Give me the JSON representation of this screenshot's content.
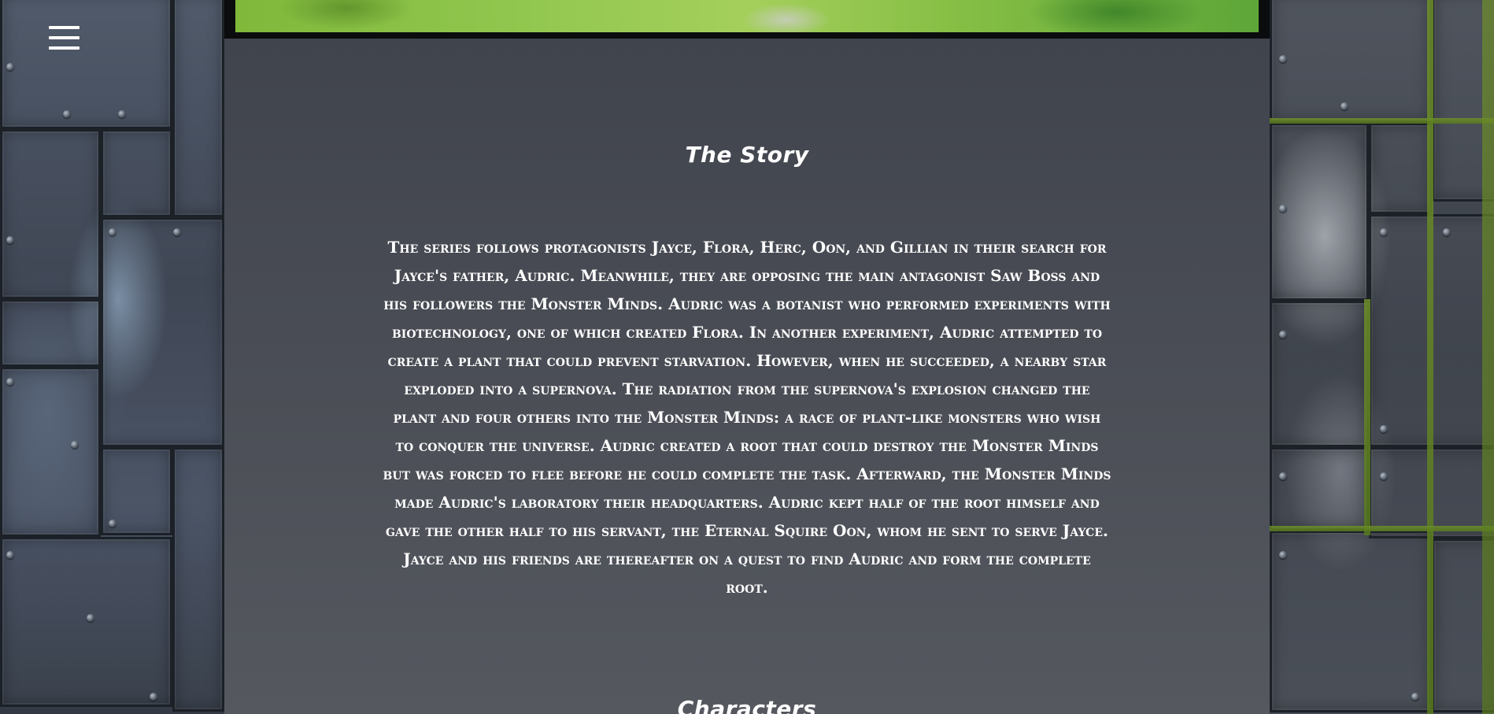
{
  "menu": {
    "icon": "hamburger-menu-icon"
  },
  "hero": {
    "description": ""
  },
  "story": {
    "title": "The Story",
    "body": "The series follows protagonists Jayce, Flora, Herc, Oon, and Gillian in their search for Jayce's father, Audric. Meanwhile, they are opposing the main antagonist Saw Boss and his followers the Monster Minds. Audric was a botanist who performed experiments with biotechnology, one of which created Flora. In another experiment, Audric attempted to create a plant that could prevent starvation. However, when he succeeded, a nearby star exploded into a supernova. The radiation from the supernova's explosion changed the plant and four others into the Monster Minds: a race of plant-like monsters who wish to conquer the universe. Audric created a root that could destroy the Monster Minds but was forced to flee before he could complete the task. Afterward, the Monster Minds made Audric's laboratory their headquarters. Audric kept half of the root himself and gave the other half to his servant, the Eternal Squire Oon, whom he sent to serve Jayce. Jayce and his friends are thereafter on a quest to find Audric and form the complete root."
  },
  "characters": {
    "title": "Characters"
  }
}
